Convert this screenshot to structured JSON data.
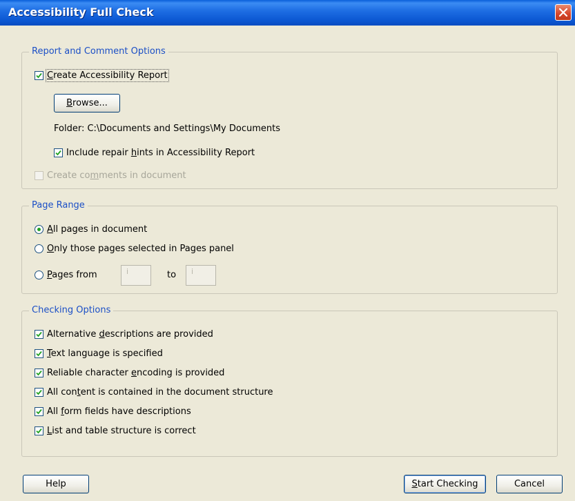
{
  "window": {
    "title": "Accessibility Full Check"
  },
  "report_group": {
    "legend": "Report and Comment Options",
    "create_report": {
      "label_pre": "",
      "label_key": "C",
      "label_post": "reate Accessibility Report",
      "checked": true
    },
    "browse_button": {
      "label_key": "B",
      "label_post": "rowse..."
    },
    "folder": "Folder: C:\\Documents and Settings\\My Documents",
    "include_hints": {
      "label_pre": "Include repair ",
      "label_key": "h",
      "label_post": "ints in Accessibility Report",
      "checked": true
    },
    "create_comments": {
      "label_pre": "Create co",
      "label_key": "m",
      "label_post": "ments in document",
      "checked": false,
      "enabled": false
    }
  },
  "page_group": {
    "legend": "Page Range",
    "all_pages": {
      "label_key": "A",
      "label_post": "ll pages in document",
      "selected": true
    },
    "selected_pages": {
      "label_key": "O",
      "label_post": "nly those pages selected in Pages panel",
      "selected": false
    },
    "pages_from": {
      "label_key": "P",
      "label_post": "ages from",
      "selected": false
    },
    "from_value": "i",
    "to_label": "to",
    "to_value": "i"
  },
  "checking_group": {
    "legend": "Checking Options",
    "options": [
      {
        "pre": "Alternative ",
        "key": "d",
        "post": "escriptions are provided",
        "checked": true
      },
      {
        "pre": "",
        "key": "T",
        "post": "ext language is specified",
        "checked": true
      },
      {
        "pre": "Reliable character ",
        "key": "e",
        "post": "ncoding is provided",
        "checked": true
      },
      {
        "pre": "All con",
        "key": "t",
        "post": "ent is contained in the document structure",
        "checked": true
      },
      {
        "pre": "All ",
        "key": "f",
        "post": "orm fields have descriptions",
        "checked": true
      },
      {
        "pre": "",
        "key": "L",
        "post": "ist and table structure is correct",
        "checked": true
      }
    ]
  },
  "buttons": {
    "help": "Help",
    "start_key": "S",
    "start_post": "tart Checking",
    "cancel": "Cancel"
  },
  "colors": {
    "title_bar": "#0b57d2",
    "legend_text": "#1b4fc6",
    "dialog_bg": "#ece9d8",
    "check_green": "#21a121"
  }
}
